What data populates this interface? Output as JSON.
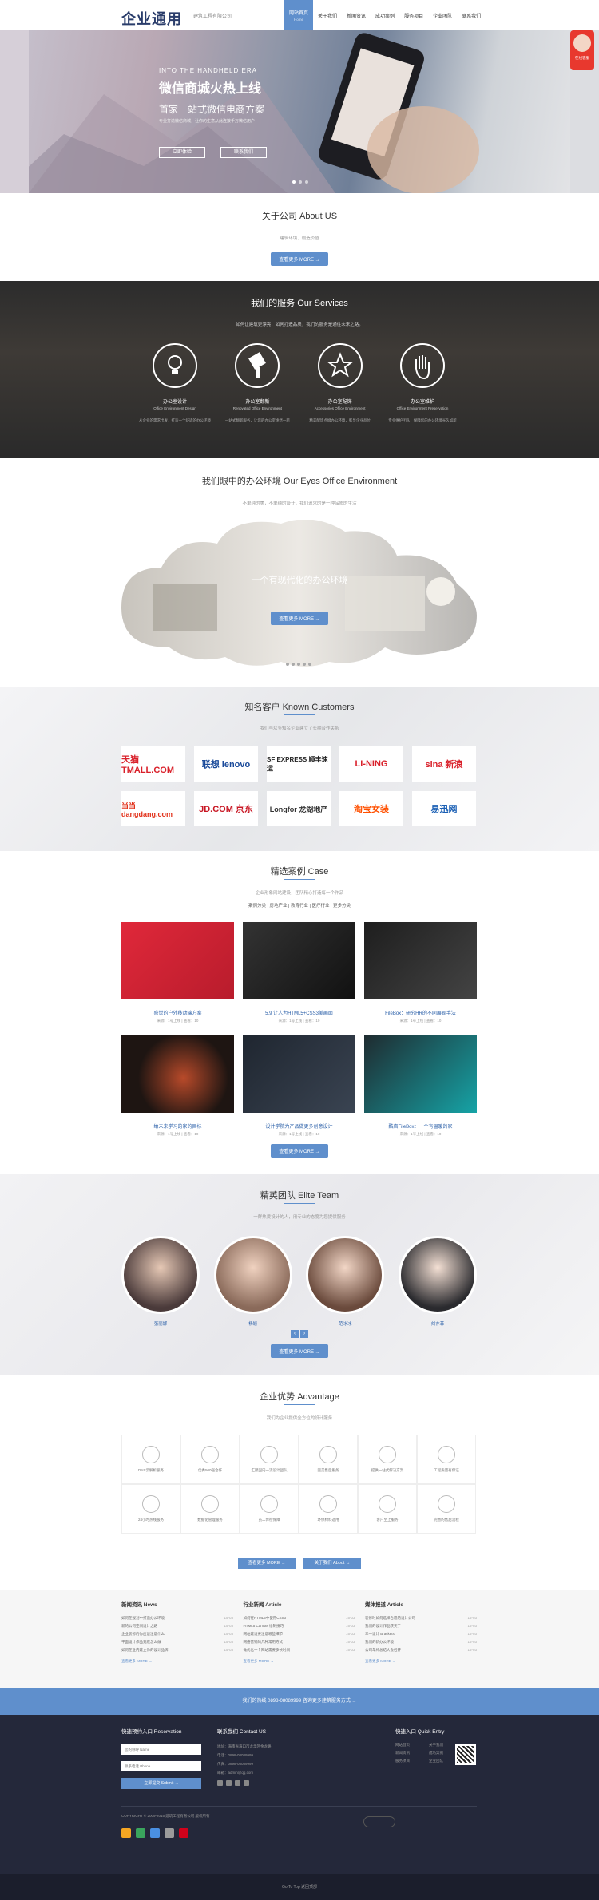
{
  "header": {
    "logo": "企业通用",
    "logo_sub": "建筑工程有限公司",
    "nav": [
      {
        "label": "网站首页",
        "sub": "Home"
      },
      {
        "label": "关于我们"
      },
      {
        "label": "新闻资讯"
      },
      {
        "label": "成功案例"
      },
      {
        "label": "服务项目"
      },
      {
        "label": "企业团队"
      },
      {
        "label": "联系我们"
      }
    ],
    "chat": "在线客服"
  },
  "banner": {
    "kicker": "INTO THE HANDHELD ERA",
    "title": "微信商城火热上线",
    "subtitle": "首家一站式微信电商方案",
    "desc": "专业打造微信商城，让你的生意从此连接千万微信用户",
    "btn1": "立即体验",
    "btn2": "联系我们"
  },
  "about": {
    "title": "关于公司 About US",
    "sub": "建筑环境、创造价值",
    "more": "查看更多 MORE →"
  },
  "services": {
    "title": "我们的服务 Our Services",
    "sub": "如何让建筑更漂亮，如何打造品质，我们的服务是通往未来之路。",
    "items": [
      {
        "cn": "办公室设计",
        "en": "Office Environment Design",
        "icon": "bulb-icon",
        "desc": "从企业的需求出发，打造一个舒适的办公环境"
      },
      {
        "cn": "办公室翻新",
        "en": "Renovated Office Environment",
        "icon": "brush-icon",
        "desc": "一站式翻新服务，让您的办公室焕然一新"
      },
      {
        "cn": "办公室配饰",
        "en": "Accessories Office Environment",
        "icon": "star-icon",
        "desc": "精美配饰点缀办公环境，彰显企业品位"
      },
      {
        "cn": "办公室维护",
        "en": "Office Environment Preservation",
        "icon": "hand-icon",
        "desc": "专业维护团队，保障您的办公环境长久如新"
      }
    ]
  },
  "env": {
    "title": "我们眼中的办公环境 Our Eyes Office Environment",
    "sub": "不单纯的美，不单纯的设计，我们追求的是一种品质的生活",
    "caption": "一个有现代化的办公环境",
    "more": "查看更多 MORE →"
  },
  "customers": {
    "title": "知名客户 Known Customers",
    "sub": "我们与众多知名企业建立了长期合作关系",
    "logos": [
      "天猫 TMALL.COM",
      "联想 lenovo",
      "SF EXPRESS 顺丰速运",
      "LI-NING",
      "sina 新浪",
      "当当 dangdang.com",
      "JD.COM 京东",
      "Longfor 龙湖地产",
      "淘宝女装",
      "易迅网"
    ]
  },
  "cases": {
    "title": "精选案例 Case",
    "sub": "企业形象网站建设，团队精心打造每一个作品",
    "filters": "案例分类 | 房地产业 | 教育行业 | 医疗行业 | 更多分类",
    "items": [
      {
        "t": "盛世的户外移动端方案",
        "m": "来源：1号上线 | 查看：10"
      },
      {
        "t": "5.9 让人为HTML5+CSS3美画面",
        "m": "来源：1号上线 | 查看：10"
      },
      {
        "t": "FileBox：研究HR的不同展现手法",
        "m": "来源：1号上线 | 查看：10"
      },
      {
        "t": "给未来学习的家的目标",
        "m": "来源：1号上线 | 查看：10"
      },
      {
        "t": "设计学院为产品做更多创意设计",
        "m": "来源：1号上线 | 查看：10"
      },
      {
        "t": "酷店FileBox：一个有温暖的家",
        "m": "来源：1号上线 | 查看：10"
      }
    ],
    "more": "查看更多 MORE →"
  },
  "team": {
    "title": "精英团队 Elite Team",
    "sub": "一群热爱设计的人，用专业的态度为您提供服务",
    "names": [
      "张丽娜",
      "杨颖",
      "范冰冰",
      "刘亦菲"
    ],
    "more": "查看更多 MORE →"
  },
  "adv": {
    "title": "企业优势 Advantage",
    "sub": "我们为企业提供全方位的设计服务",
    "items": [
      "DNS云解析服务",
      "优秀500强合作",
      "汇聚国内一流设计团队",
      "完美售后服务",
      "提供一站式解决方案",
      "工程质量有保证",
      "24小时热线服务",
      "数据化管理服务",
      "员工体检保障",
      "环保材料选用",
      "客户至上服务",
      "完善的售后流程"
    ],
    "btn1": "查看更多 MORE →",
    "btn2": "关于我们 About →"
  },
  "news": {
    "cols": [
      {
        "h": "新闻资讯 News",
        "items": [
          [
            "如何在规划中打造办公环境",
            "15-03"
          ],
          [
            "新的公司空间设计之路",
            "15-03"
          ],
          [
            "企业装修的你应该注意什么",
            "15-03"
          ],
          [
            "平面设计作品到底怎么做",
            "15-03"
          ],
          [
            "如何在业内建立你的设计品牌",
            "15-03"
          ]
        ]
      },
      {
        "h": "行业新闻 Article",
        "items": [
          [
            "如何在HTML5中使用CSS3",
            "15-03"
          ],
          [
            "HTML5 Canvas 绘制技巧",
            "15-03"
          ],
          [
            "网站建设要注意哪些细节",
            "15-03"
          ],
          [
            "网络营销的几种常用方式",
            "15-03"
          ],
          [
            "做优化一个网站需要多长时间",
            "15-03"
          ]
        ]
      },
      {
        "h": "媒体报道 Article",
        "items": [
          [
            "装修时如何选择合适的设计公司",
            "15-03"
          ],
          [
            "我们的设计作品获奖了",
            "15-03"
          ],
          [
            "三一设计 Brackets",
            "15-03"
          ],
          [
            "我们的新办公环境",
            "15-03"
          ],
          [
            "公司年终总结大会召开",
            "15-03"
          ]
        ]
      }
    ],
    "more": "查看更多 MORE →"
  },
  "strip": "我们的热线 0898-08089999 咨询更多建筑服务方式 →",
  "footer": {
    "res": "快速预约入口 Reservation",
    "name_ph": "您的称呼 Name",
    "phone_ph": "联系电话 Phone",
    "submit": "立即提交 Submit →",
    "contact": "联系我们 Contact US",
    "addr": "地址：海南省海口市龙华区金龙路",
    "tel": "电话：0898-08089999",
    "fax": "传真：0898-08089999",
    "email": "邮箱：admin@qq.com",
    "quick": "快速入口 Quick Entry",
    "links": [
      "网站首页",
      "关于我们",
      "新闻资讯",
      "成功案例",
      "服务项目",
      "企业团队"
    ],
    "copy": "COPYRIGHT © 2009-2015 建筑工程有限公司 版权所有"
  },
  "totop": "Go To Top 返回顶部",
  "colors": {
    "accent": "#5f8fcc",
    "dark": "#24283a"
  }
}
